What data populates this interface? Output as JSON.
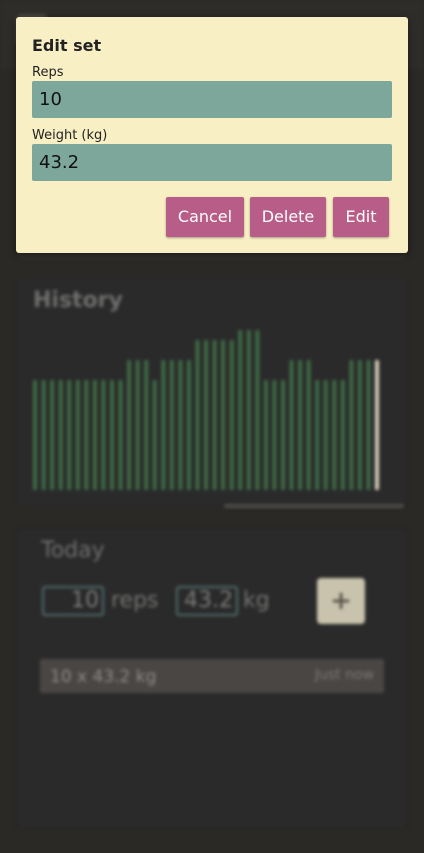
{
  "dialog": {
    "title": "Edit set",
    "reps_label": "Reps",
    "reps_value": "10",
    "weight_label": "Weight (kg)",
    "weight_value": "43.2",
    "cancel_label": "Cancel",
    "delete_label": "Delete",
    "edit_label": "Edit"
  },
  "history": {
    "title": "History",
    "bar_color": "#3e6b44",
    "highlight_color": "#d8d0b8"
  },
  "chart_data": {
    "type": "bar",
    "values": [
      0.55,
      0.55,
      0.55,
      0.55,
      0.55,
      0.55,
      0.55,
      0.55,
      0.55,
      0.55,
      0.55,
      0.65,
      0.65,
      0.65,
      0.55,
      0.65,
      0.65,
      0.65,
      0.65,
      0.75,
      0.75,
      0.75,
      0.75,
      0.75,
      0.8,
      0.8,
      0.8,
      0.55,
      0.55,
      0.55,
      0.65,
      0.65,
      0.65,
      0.55,
      0.55,
      0.55,
      0.55,
      0.65,
      0.65,
      0.65,
      0.65
    ],
    "highlighted_last": true
  },
  "today": {
    "title": "Today",
    "reps_value": "10",
    "reps_unit": "reps",
    "weight_value": "43.2",
    "weight_unit": "kg",
    "add_label": "+",
    "sets": [
      {
        "text": "10 x 43.2 kg",
        "time": "Just now"
      }
    ]
  }
}
